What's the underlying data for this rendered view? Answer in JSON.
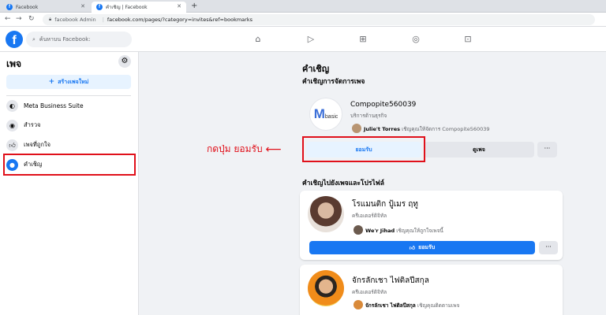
{
  "browser": {
    "tabs": [
      {
        "title": "Facebook"
      },
      {
        "title": "คำเชิญ | Facebook"
      }
    ],
    "new_tab": "+",
    "address": {
      "site_name": "facebook Admin",
      "url": "facebook.com/pages/?category=invites&ref=bookmarks"
    }
  },
  "header": {
    "logo": "f",
    "search_placeholder": "ค้นหาบน Facebook:"
  },
  "sidebar": {
    "title": "เพจ",
    "create_button": "สร้างเพจใหม่",
    "items": [
      {
        "label": "Meta Business Suite",
        "icon": "meta-business-icon"
      },
      {
        "label": "สำรวจ",
        "icon": "compass-icon"
      },
      {
        "label": "เพจที่ถูกใจ",
        "icon": "like-icon"
      },
      {
        "label": "คำเชิญ",
        "icon": "invite-person-icon"
      }
    ]
  },
  "main": {
    "title": "คำเชิญ",
    "manage_section_title": "คำเชิญการจัดการเพจ",
    "page_invite": {
      "logo_m": "M",
      "logo_text": "basic",
      "name": "Compopite560039",
      "category": "บริการด้านธุรกิจ",
      "inviter": "Julie't Torres",
      "invite_text": "เชิญคุณให้จัดการ Compopite560039",
      "accept_label": "ยอมรับ",
      "view_label": "ดูเพจ",
      "more_label": "···"
    },
    "annotation": "กดปุ่ม ยอมรับ",
    "annotation_arrow": "⟵",
    "like_section_title": "คำเชิญไปยังเพจและโปรไฟล์",
    "profile_invites": [
      {
        "name": "โรแมนติก ปู้เมร ฤทู",
        "category": "ครีเอเตอร์ดิจิทัล",
        "inviter": "We'r Jihad",
        "invite_text": "เชิญคุณให้ถูกใจเพจนี้",
        "accept_label": "ยอมรับ",
        "more_label": "···"
      },
      {
        "name": "จักรลักเชา ไฟติลปีสกุล",
        "category": "ครีเอเตอร์ดิจิทัล",
        "inviter": "จักรลักเชา ไฟติลปีสกุล",
        "invite_text": "เชิญคุณติดตามเพจ"
      }
    ]
  },
  "colors": {
    "fb_blue": "#1877f2",
    "annotation_red": "#e0101a"
  }
}
